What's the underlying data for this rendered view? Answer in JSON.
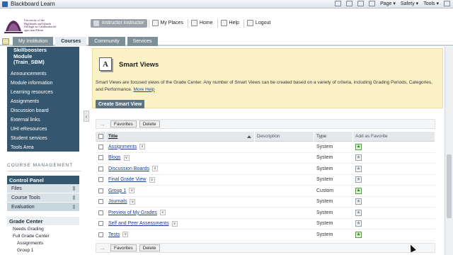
{
  "browser": {
    "title": "Blackboard Learn",
    "tools": [
      "Page ▾",
      "Safety ▾",
      "Tools ▾"
    ]
  },
  "logo": {
    "lines": [
      "University of the",
      "Highlands and Islands",
      "Oilthigh na Gàidhealtachd",
      "agus nan Eilean"
    ]
  },
  "usernav": {
    "user": "instructor instructor",
    "links": [
      {
        "label": "My Places",
        "icon": "places-icon"
      },
      {
        "label": "Home",
        "icon": "home-icon"
      },
      {
        "label": "Help",
        "icon": "help-icon"
      },
      {
        "label": "Logout",
        "icon": "logout-icon"
      }
    ]
  },
  "tabs": [
    "My Institution",
    "Courses",
    "Community",
    "Services"
  ],
  "course": {
    "title_line1": "Skillboosters",
    "title_line2": "Module",
    "title_line3": "(Train_SBM)",
    "items": [
      "Announcements",
      "Module information",
      "Learning resources",
      "Assignments",
      "Discussion board",
      "External links",
      "UHI eResources",
      "Student services",
      "Tools Area"
    ]
  },
  "course_management": {
    "heading": "COURSE MANAGEMENT",
    "control_panel": "Control Panel",
    "cp_items": [
      "Files",
      "Course Tools",
      "Evaluation"
    ],
    "grade_center": "Grade Center",
    "gc_items": [
      "Needs Grading",
      "Full Grade Center"
    ],
    "gc_sub_items": [
      "Assignments",
      "Group 1"
    ]
  },
  "main": {
    "page_title": "Smart Views",
    "icon_letter": "A",
    "description": "Smart Views are focused views of the Grade Center. Any number of Smart Views can be created based on a variety of criteria, including Grading Periods, Categories, and Performance.",
    "more_help": "More Help",
    "create_button": "Create Smart View",
    "action_buttons": [
      "Favorites",
      "Delete"
    ],
    "columns": [
      "Title",
      "Description",
      "Type",
      "Add as Favorite"
    ],
    "rows": [
      {
        "title": "Assignments",
        "type": "System",
        "favorite": true
      },
      {
        "title": "Blogs",
        "type": "System",
        "favorite": false
      },
      {
        "title": "Discussion Boards",
        "type": "System",
        "favorite": false
      },
      {
        "title": "Final Grade View",
        "type": "System",
        "favorite": false
      },
      {
        "title": "Group 1",
        "type": "Custom",
        "favorite": true
      },
      {
        "title": "Journals",
        "type": "System",
        "favorite": false
      },
      {
        "title": "Preview of My Grades",
        "type": "System",
        "favorite": false
      },
      {
        "title": "Self and Peer Assessments",
        "type": "System",
        "favorite": false
      },
      {
        "title": "Tests",
        "type": "System",
        "favorite": true
      }
    ]
  },
  "colors": {
    "course_panel": "#34566e",
    "header_bg": "#fbf1c6",
    "tab_inactive": "#7e9097",
    "link": "#1a3f8f",
    "favorite_on": "#2f8f26"
  }
}
